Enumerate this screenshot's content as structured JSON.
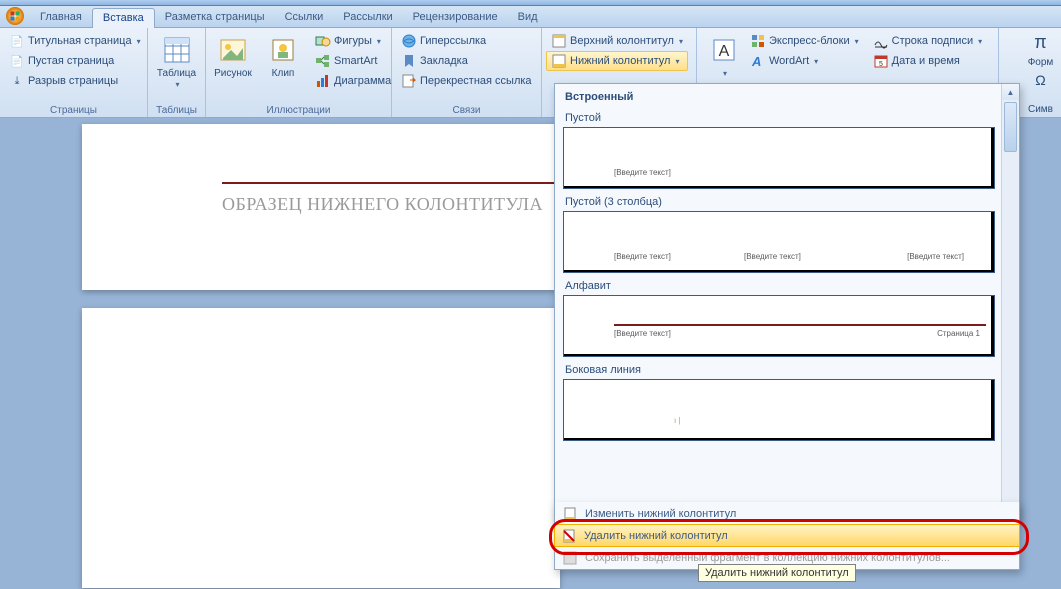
{
  "tabs": {
    "home": "Главная",
    "insert": "Вставка",
    "layout": "Разметка страницы",
    "refs": "Ссылки",
    "mail": "Рассылки",
    "review": "Рецензирование",
    "view": "Вид"
  },
  "ribbon": {
    "pages": {
      "label": "Страницы",
      "cover": "Титульная страница",
      "blank": "Пустая страница",
      "break": "Разрыв страницы"
    },
    "tables": {
      "label": "Таблицы",
      "table": "Таблица"
    },
    "illus": {
      "label": "Иллюстрации",
      "picture": "Рисунок",
      "clip": "Клип",
      "shapes": "Фигуры",
      "smartart": "SmartArt",
      "chart": "Диаграмма"
    },
    "links": {
      "label": "Связи",
      "hyperlink": "Гиперссылка",
      "bookmark": "Закладка",
      "crossref": "Перекрестная ссылка"
    },
    "hf": {
      "header": "Верхний колонтитул",
      "footer": "Нижний колонтитул"
    },
    "text": {
      "textbox": "A",
      "quickparts": "Экспресс-блоки",
      "wordart": "WordArt",
      "sigline": "Строка подписи",
      "datetime": "Дата и время"
    },
    "symbols": {
      "label": "Симв",
      "formula": "Форм"
    }
  },
  "doc": {
    "title": "ОБРАЗЕЦ НИЖНЕГО КОЛОНТИТУЛА"
  },
  "gallery": {
    "builtin": "Встроенный",
    "items": {
      "blank": {
        "title": "Пустой",
        "ph": "[Введите текст]"
      },
      "blank3": {
        "title": "Пустой (3 столбца)",
        "ph1": "[Введите текст]",
        "ph2": "[Введите текст]",
        "ph3": "[Введите текст]"
      },
      "alpha": {
        "title": "Алфавит",
        "ph": "[Введите текст]",
        "page": "Страница 1"
      },
      "sideline": {
        "title": "Боковая линия",
        "ph": "|"
      }
    },
    "edit": "Изменить нижний колонтитул",
    "remove": "Удалить нижний колонтитул",
    "save": "Сохранить выделенный фрагмент в коллекцию нижних колонтитулов..."
  },
  "tooltip": "Удалить нижний колонтитул"
}
